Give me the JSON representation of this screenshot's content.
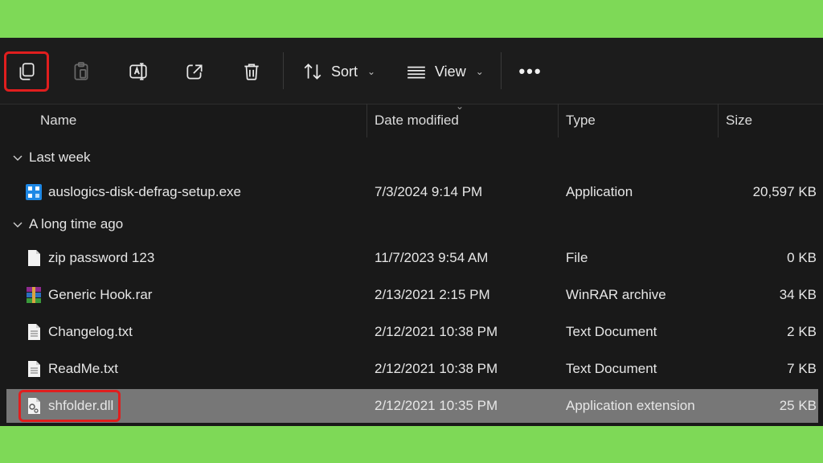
{
  "toolbar": {
    "copy_icon": "copy-icon",
    "paste_icon": "paste-icon",
    "rename_icon": "rename-icon",
    "share_icon": "share-icon",
    "delete_icon": "trash-icon",
    "sort_label": "Sort",
    "view_label": "View",
    "more_label": "•••"
  },
  "columns": {
    "name": "Name",
    "date": "Date modified",
    "type": "Type",
    "size": "Size"
  },
  "groups": [
    {
      "label": "Last week"
    },
    {
      "label": "A long time ago"
    }
  ],
  "files": [
    {
      "name": "auslogics-disk-defrag-setup.exe",
      "date": "7/3/2024 9:14 PM",
      "type": "Application",
      "size": "20,597 KB",
      "icon": "app-installer-icon"
    },
    {
      "name": "zip password 123",
      "date": "11/7/2023 9:54 AM",
      "type": "File",
      "size": "0 KB",
      "icon": "blank-file-icon"
    },
    {
      "name": "Generic Hook.rar",
      "date": "2/13/2021 2:15 PM",
      "type": "WinRAR archive",
      "size": "34 KB",
      "icon": "winrar-archive-icon"
    },
    {
      "name": "Changelog.txt",
      "date": "2/12/2021 10:38 PM",
      "type": "Text Document",
      "size": "2 KB",
      "icon": "text-file-icon"
    },
    {
      "name": "ReadMe.txt",
      "date": "2/12/2021 10:38 PM",
      "type": "Text Document",
      "size": "7 KB",
      "icon": "text-file-icon"
    },
    {
      "name": "shfolder.dll",
      "date": "2/12/2021 10:35 PM",
      "type": "Application extension",
      "size": "25 KB",
      "icon": "dll-file-icon"
    }
  ],
  "colors": {
    "background": "#7ed957",
    "window": "#191919",
    "selected_row": "#777777",
    "highlight": "#e01e1e"
  }
}
